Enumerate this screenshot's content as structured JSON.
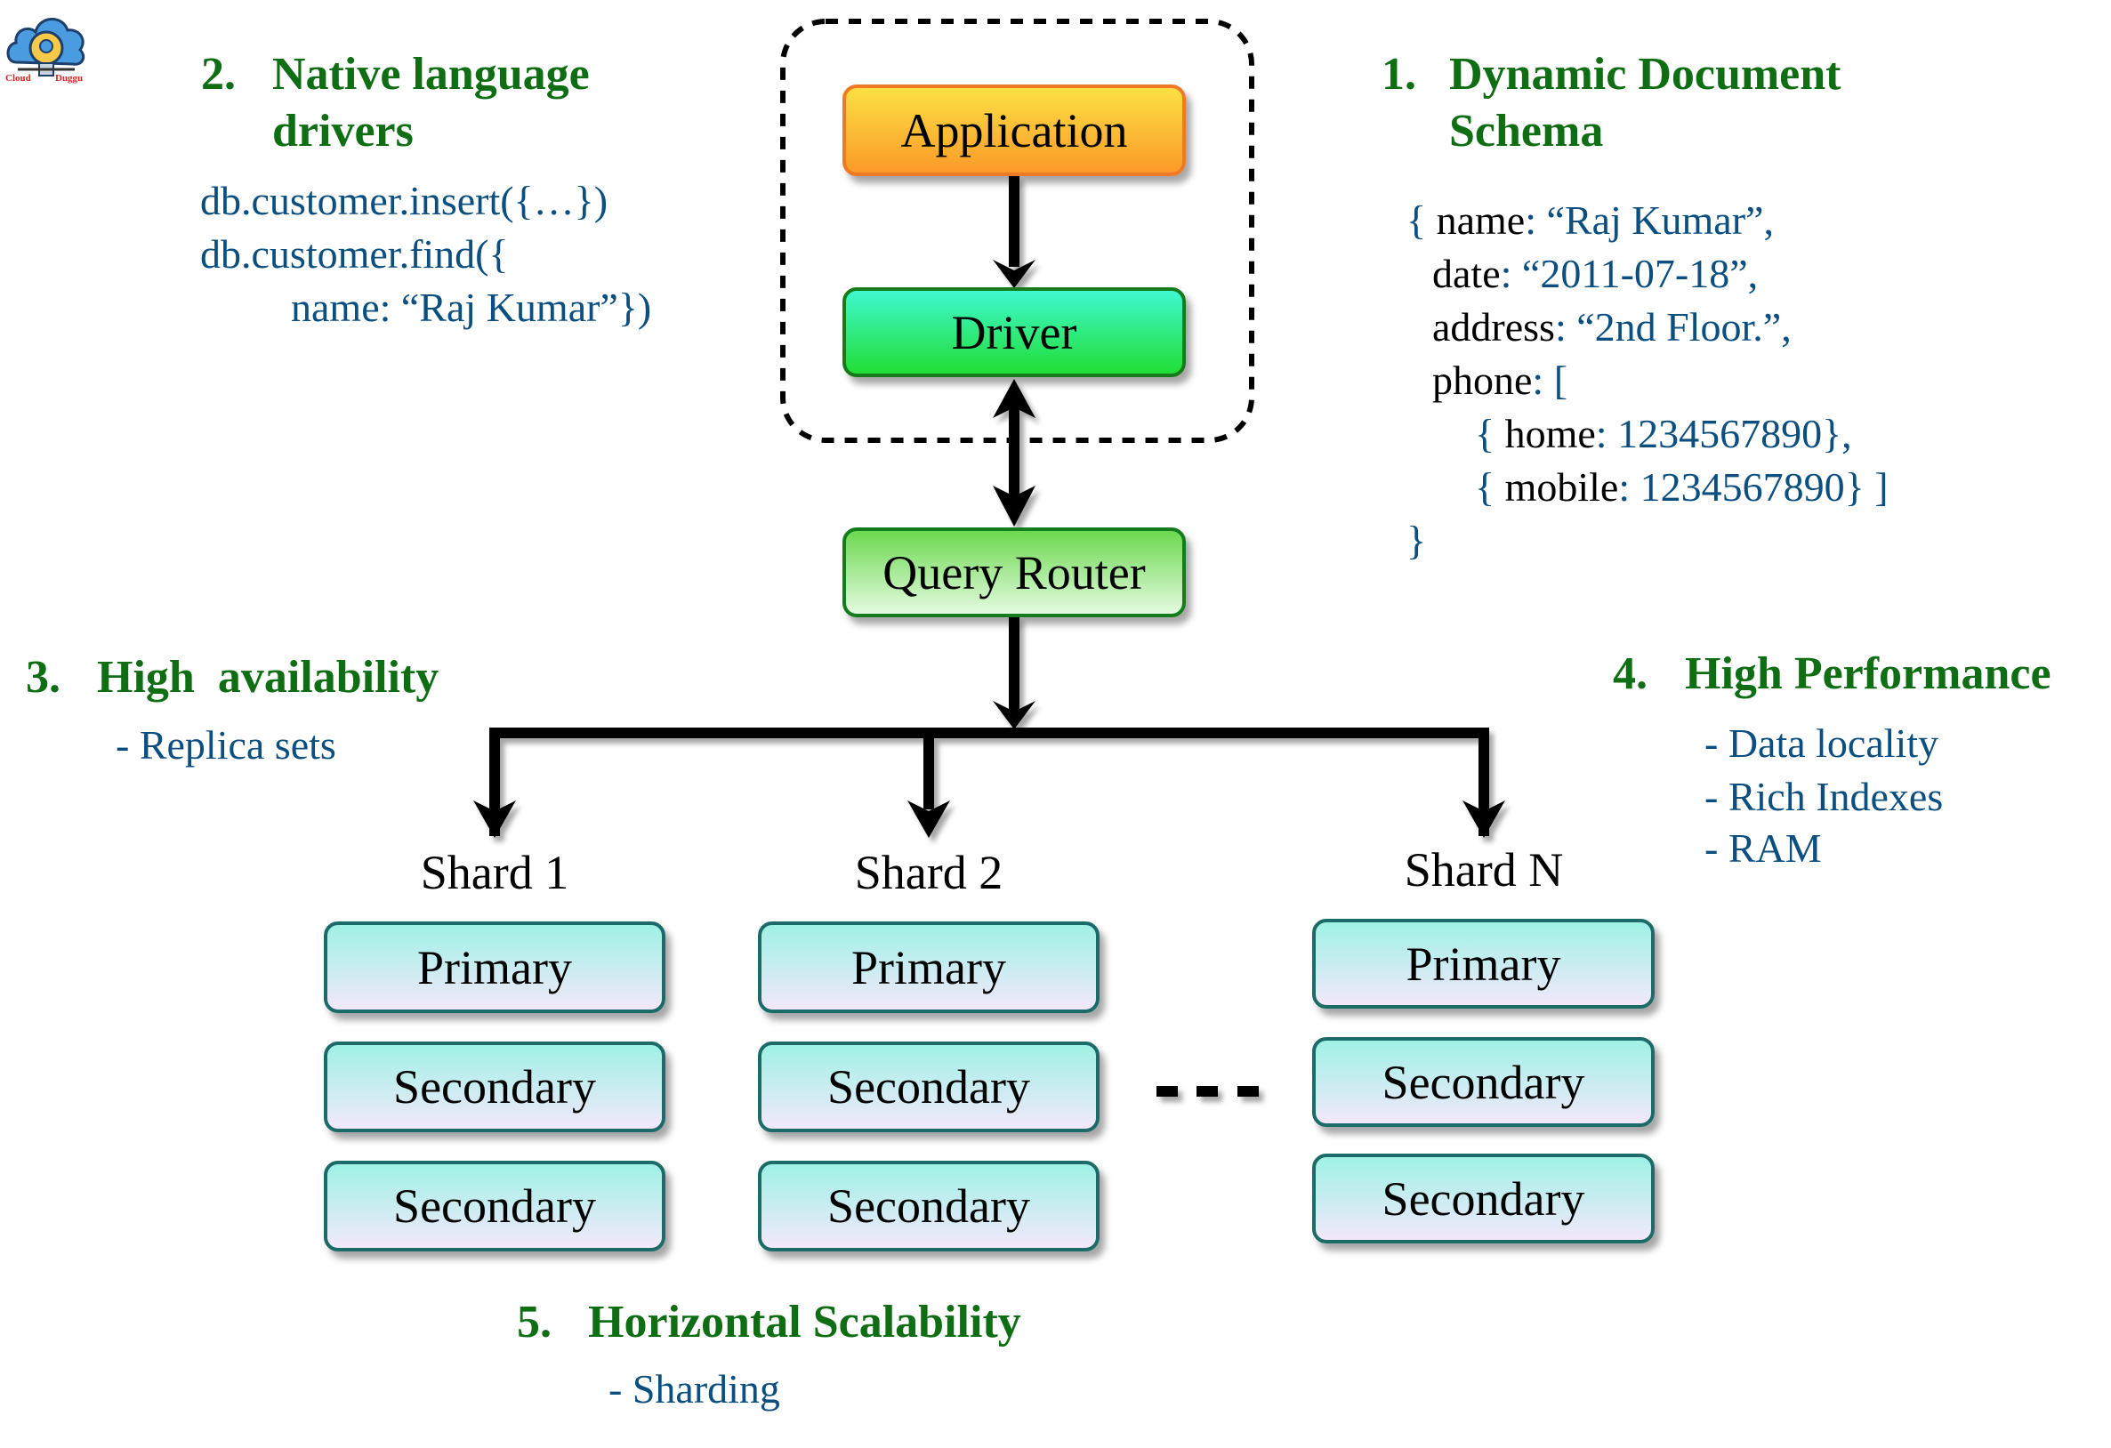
{
  "logo": {
    "brand_left": "Cloud",
    "brand_right": "Duggu"
  },
  "colors": {
    "heading": "#0f6e14",
    "detail": "#0b4e80",
    "application": "#fb9a28",
    "driver": "#22de34",
    "query_router": "#6cd84f",
    "replica": "#9ff1e6"
  },
  "sections": {
    "dynamic_schema": {
      "number": "1.",
      "title_lines": [
        "Dynamic Document",
        "Schema"
      ],
      "code": [
        {
          "open": "{ ",
          "key": "name",
          "sep": ": ",
          "value": "“Raj Kumar”,"
        },
        {
          "open": "",
          "key": "date",
          "sep": ": ",
          "value": "“2011-07-18”,"
        },
        {
          "open": "",
          "key": "address",
          "sep": ": ",
          "value": "“2nd Floor.”,"
        },
        {
          "open": "",
          "key": "phone",
          "sep": ": ",
          "value": "["
        },
        {
          "open": "{ ",
          "key": "home",
          "sep": ": ",
          "value": "1234567890},"
        },
        {
          "open": "{ ",
          "key": "mobile",
          "sep": ": ",
          "value": "1234567890} ]"
        },
        {
          "open": "}",
          "key": "",
          "sep": "",
          "value": ""
        }
      ]
    },
    "native_drivers": {
      "number": "2.",
      "title_lines": [
        "Native language",
        "drivers"
      ],
      "code": [
        "db.customer.insert({…})",
        "db.customer.find({",
        "name: “Raj Kumar”})"
      ]
    },
    "high_availability": {
      "number": "3.",
      "title": "High  availability",
      "bullets": [
        "- Replica sets"
      ]
    },
    "high_performance": {
      "number": "4.",
      "title": "High Performance",
      "bullets": [
        "- Data locality",
        "- Rich Indexes",
        "- RAM"
      ]
    },
    "horizontal_scalability": {
      "number": "5.",
      "title": "Horizontal Scalability",
      "bullets": [
        "- Sharding"
      ]
    }
  },
  "architecture": {
    "application": "Application",
    "driver": "Driver",
    "query_router": "Query Router",
    "shards": [
      {
        "label": "Shard 1",
        "nodes": [
          "Primary",
          "Secondary",
          "Secondary"
        ]
      },
      {
        "label": "Shard 2",
        "nodes": [
          "Primary",
          "Secondary",
          "Secondary"
        ]
      },
      {
        "label": "Shard N",
        "nodes": [
          "Primary",
          "Secondary",
          "Secondary"
        ]
      }
    ],
    "ellipsis": "- - -"
  }
}
